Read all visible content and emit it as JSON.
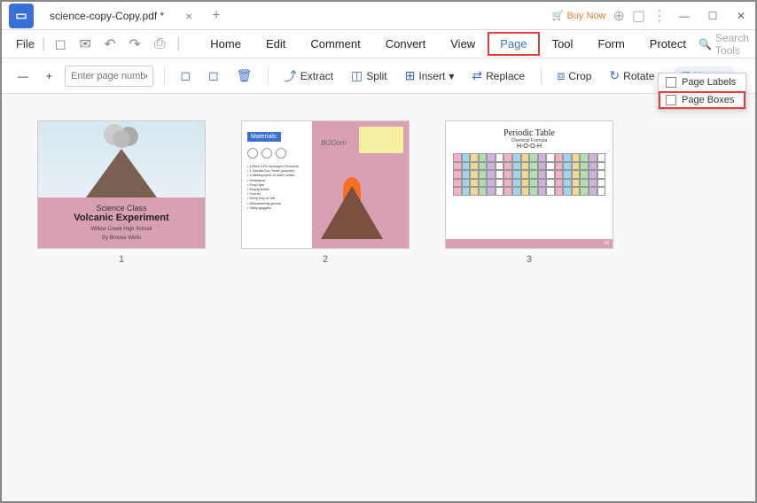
{
  "titlebar": {
    "tab_name": "science-copy-Copy.pdf *",
    "buy_now": "Buy Now"
  },
  "menubar": {
    "file": "File",
    "tabs": [
      "Home",
      "Edit",
      "Comment",
      "Convert",
      "View",
      "Page",
      "Tool",
      "Form",
      "Protect"
    ],
    "active_tab_index": 5,
    "search_placeholder": "Search Tools"
  },
  "toolbar": {
    "page_placeholder": "Enter page number",
    "extract": "Extract",
    "split": "Split",
    "insert": "Insert",
    "replace": "Replace",
    "crop": "Crop",
    "rotate": "Rotate",
    "more": "More"
  },
  "dropdown": {
    "page_labels": "Page Labels",
    "page_boxes": "Page Boxes"
  },
  "thumbnails": {
    "pages": [
      "1",
      "2",
      "3"
    ],
    "slide1": {
      "subtitle": "Science Class",
      "title": "Volcanic Experiment",
      "school": "Willow Creek High School",
      "author": "By Brooke Wells"
    },
    "slide2": {
      "materials_label": "Materials:",
      "boom": "BOOom",
      "list": "• 125ml 10% Hydrogen Peroxide\n• 1 Sachet Dry Yeast (powder)\n• 4 tablespoons of warm water\n• Detergent\n• Food dye\n• Empty bottle\n• Funnel\n• Deep tray or tub\n• Dishwashing gloves\n• Safty goggles"
    },
    "slide3": {
      "title": "Periodic Table",
      "subtitle": "Chemical Formula",
      "formula": "H-O-O-H",
      "page_num": "03"
    }
  }
}
